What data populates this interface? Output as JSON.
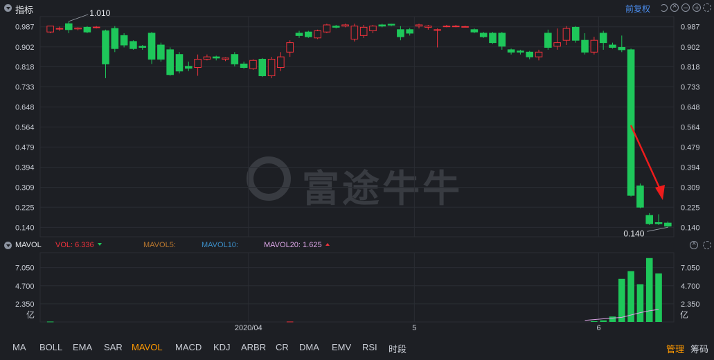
{
  "header": {
    "title": "指标",
    "adjust_label": "前复权"
  },
  "colors": {
    "up": "#f0323c",
    "down": "#1ec75a",
    "grid": "#2a2d33",
    "axis_text": "#c8ccd4",
    "mavol20": "#dba5e6",
    "arrow": "#ee1c1c"
  },
  "chart_data": [
    {
      "type": "candlestick",
      "y_ticks": [
        "0.987",
        "0.902",
        "0.818",
        "0.733",
        "0.648",
        "0.564",
        "0.479",
        "0.394",
        "0.309",
        "0.225",
        "0.140"
      ],
      "ylim": [
        0.1,
        1.03
      ],
      "x_labels": [
        {
          "label": "2020/04",
          "index": 22
        },
        {
          "label": "5",
          "index": 40
        },
        {
          "label": "6",
          "index": 60
        }
      ],
      "annotations": {
        "high": "1.010",
        "low": "0.140"
      },
      "candles": [
        {
          "o": 0.965,
          "h": 0.99,
          "l": 0.96,
          "c": 0.99
        },
        {
          "o": 0.978,
          "h": 0.988,
          "l": 0.97,
          "c": 0.98
        },
        {
          "o": 1.0,
          "h": 1.01,
          "l": 0.96,
          "c": 0.975
        },
        {
          "o": 0.978,
          "h": 0.985,
          "l": 0.972,
          "c": 0.982
        },
        {
          "o": 0.985,
          "h": 0.99,
          "l": 0.96,
          "c": 0.965
        },
        {
          "o": 0.984,
          "h": 0.99,
          "l": 0.98,
          "c": 0.986
        },
        {
          "o": 0.97,
          "h": 0.975,
          "l": 0.77,
          "c": 0.83
        },
        {
          "o": 0.98,
          "h": 0.99,
          "l": 0.88,
          "c": 0.895
        },
        {
          "o": 0.95,
          "h": 0.96,
          "l": 0.9,
          "c": 0.91
        },
        {
          "o": 0.925,
          "h": 0.93,
          "l": 0.89,
          "c": 0.895
        },
        {
          "o": 0.905,
          "h": 0.91,
          "l": 0.89,
          "c": 0.9
        },
        {
          "o": 0.96,
          "h": 0.965,
          "l": 0.83,
          "c": 0.85
        },
        {
          "o": 0.91,
          "h": 0.92,
          "l": 0.84,
          "c": 0.85
        },
        {
          "o": 0.89,
          "h": 0.9,
          "l": 0.78,
          "c": 0.785
        },
        {
          "o": 0.87,
          "h": 0.88,
          "l": 0.79,
          "c": 0.8
        },
        {
          "o": 0.82,
          "h": 0.84,
          "l": 0.8,
          "c": 0.812
        },
        {
          "o": 0.815,
          "h": 0.87,
          "l": 0.78,
          "c": 0.85
        },
        {
          "o": 0.85,
          "h": 0.87,
          "l": 0.845,
          "c": 0.86
        },
        {
          "o": 0.86,
          "h": 0.865,
          "l": 0.845,
          "c": 0.855
        },
        {
          "o": 0.85,
          "h": 0.858,
          "l": 0.842,
          "c": 0.855
        },
        {
          "o": 0.87,
          "h": 0.88,
          "l": 0.82,
          "c": 0.83
        },
        {
          "o": 0.83,
          "h": 0.84,
          "l": 0.81,
          "c": 0.815
        },
        {
          "o": 0.81,
          "h": 0.85,
          "l": 0.805,
          "c": 0.845
        },
        {
          "o": 0.85,
          "h": 0.855,
          "l": 0.775,
          "c": 0.78
        },
        {
          "o": 0.78,
          "h": 0.86,
          "l": 0.77,
          "c": 0.85
        },
        {
          "o": 0.815,
          "h": 0.88,
          "l": 0.8,
          "c": 0.86
        },
        {
          "o": 0.88,
          "h": 0.93,
          "l": 0.86,
          "c": 0.92
        },
        {
          "o": 0.96,
          "h": 0.97,
          "l": 0.94,
          "c": 0.95
        },
        {
          "o": 0.965,
          "h": 0.97,
          "l": 0.94,
          "c": 0.945
        },
        {
          "o": 0.94,
          "h": 0.975,
          "l": 0.935,
          "c": 0.97
        },
        {
          "o": 0.965,
          "h": 1.0,
          "l": 0.96,
          "c": 0.995
        },
        {
          "o": 0.99,
          "h": 0.995,
          "l": 0.98,
          "c": 0.985
        },
        {
          "o": 0.99,
          "h": 1.0,
          "l": 0.985,
          "c": 0.995
        },
        {
          "o": 0.935,
          "h": 1.0,
          "l": 0.925,
          "c": 0.99
        },
        {
          "o": 0.95,
          "h": 0.995,
          "l": 0.94,
          "c": 0.985
        },
        {
          "o": 0.97,
          "h": 0.995,
          "l": 0.96,
          "c": 0.99
        },
        {
          "o": 0.995,
          "h": 1.0,
          "l": 0.985,
          "c": 0.99
        },
        {
          "o": 0.998,
          "h": 1.0,
          "l": 0.99,
          "c": 0.994
        },
        {
          "o": 0.975,
          "h": 0.99,
          "l": 0.93,
          "c": 0.945
        },
        {
          "o": 0.975,
          "h": 0.982,
          "l": 0.95,
          "c": 0.96
        },
        {
          "o": 0.99,
          "h": 1.0,
          "l": 0.98,
          "c": 0.995
        },
        {
          "o": 0.985,
          "h": 0.995,
          "l": 0.975,
          "c": 0.99
        },
        {
          "o": 0.975,
          "h": 0.98,
          "l": 0.9,
          "c": 0.975
        },
        {
          "o": 0.99,
          "h": 0.995,
          "l": 0.985,
          "c": 0.99
        },
        {
          "o": 0.99,
          "h": 0.995,
          "l": 0.985,
          "c": 0.99
        },
        {
          "o": 0.988,
          "h": 0.992,
          "l": 0.985,
          "c": 0.988
        },
        {
          "o": 0.975,
          "h": 0.98,
          "l": 0.96,
          "c": 0.965
        },
        {
          "o": 0.96,
          "h": 0.965,
          "l": 0.94,
          "c": 0.945
        },
        {
          "o": 0.96,
          "h": 0.965,
          "l": 0.915,
          "c": 0.92
        },
        {
          "o": 0.96,
          "h": 0.965,
          "l": 0.89,
          "c": 0.905
        },
        {
          "o": 0.89,
          "h": 0.895,
          "l": 0.87,
          "c": 0.88
        },
        {
          "o": 0.885,
          "h": 0.89,
          "l": 0.87,
          "c": 0.88
        },
        {
          "o": 0.88,
          "h": 0.885,
          "l": 0.85,
          "c": 0.86
        },
        {
          "o": 0.86,
          "h": 0.89,
          "l": 0.845,
          "c": 0.88
        },
        {
          "o": 0.96,
          "h": 0.975,
          "l": 0.89,
          "c": 0.9
        },
        {
          "o": 0.905,
          "h": 0.98,
          "l": 0.89,
          "c": 0.92
        },
        {
          "o": 0.93,
          "h": 0.99,
          "l": 0.91,
          "c": 0.98
        },
        {
          "o": 0.985,
          "h": 0.99,
          "l": 0.92,
          "c": 0.93
        },
        {
          "o": 0.93,
          "h": 0.96,
          "l": 0.87,
          "c": 0.88
        },
        {
          "o": 0.88,
          "h": 0.945,
          "l": 0.87,
          "c": 0.93
        },
        {
          "o": 0.96,
          "h": 0.97,
          "l": 0.89,
          "c": 0.92
        },
        {
          "o": 0.91,
          "h": 0.92,
          "l": 0.895,
          "c": 0.9
        },
        {
          "o": 0.9,
          "h": 0.95,
          "l": 0.88,
          "c": 0.89
        },
        {
          "o": 0.89,
          "h": 0.895,
          "l": 0.27,
          "c": 0.275
        },
        {
          "o": 0.315,
          "h": 0.325,
          "l": 0.22,
          "c": 0.225
        },
        {
          "o": 0.19,
          "h": 0.2,
          "l": 0.15,
          "c": 0.155
        },
        {
          "o": 0.16,
          "h": 0.195,
          "l": 0.15,
          "c": 0.155
        },
        {
          "o": 0.158,
          "h": 0.165,
          "l": 0.14,
          "c": 0.145
        }
      ]
    },
    {
      "type": "bar",
      "indicator": "MAVOL",
      "unit": "亿",
      "y_ticks": [
        "7.050",
        "4.700",
        "2.350"
      ],
      "ylim": [
        0,
        9.0
      ],
      "volumes": [
        0.05,
        0,
        0,
        0,
        0,
        0,
        0,
        0,
        0,
        0,
        0,
        0,
        0,
        0,
        0,
        0,
        0,
        0,
        0,
        0,
        0,
        0,
        0,
        0,
        0,
        0,
        0.05,
        0,
        0,
        0,
        0,
        0,
        0,
        0,
        0,
        0,
        0,
        0,
        0,
        0,
        0,
        0,
        0,
        0,
        0,
        0,
        0,
        0,
        0,
        0,
        0,
        0,
        0,
        0,
        0,
        0,
        0,
        0,
        0,
        0.1,
        0.2,
        0.7,
        5.6,
        6.6,
        4.9,
        8.3,
        6.3
      ],
      "vol_up": [
        false,
        false,
        false,
        false,
        false,
        false,
        false,
        false,
        false,
        false,
        false,
        false,
        false,
        false,
        false,
        false,
        false,
        false,
        false,
        false,
        false,
        false,
        false,
        false,
        false,
        false,
        true,
        false,
        false,
        false,
        false,
        false,
        false,
        false,
        false,
        false,
        false,
        false,
        false,
        false,
        false,
        false,
        false,
        false,
        false,
        false,
        false,
        false,
        false,
        false,
        false,
        false,
        false,
        false,
        false,
        false,
        false,
        false,
        false,
        false,
        false,
        false,
        false,
        false,
        false,
        false,
        false
      ],
      "mavol20": [
        0.2,
        0.3,
        0.4,
        0.5,
        0.6,
        0.9,
        1.2,
        1.45,
        1.625
      ]
    }
  ],
  "volume_header": {
    "name": "MAVOL",
    "vol_label": "VOL: 6.336",
    "mavol5_label": "MAVOL5:",
    "mavol10_label": "MAVOL10:",
    "mavol20_label": "MAVOL20: 1.625"
  },
  "indicator_tabs": [
    "MA",
    "BOLL",
    "EMA",
    "SAR",
    "MAVOL",
    "MACD",
    "KDJ",
    "ARBR",
    "CR",
    "DMA",
    "EMV",
    "RSI",
    "时段"
  ],
  "active_tab": "MAVOL",
  "right_tabs": [
    "管理",
    "筹码"
  ],
  "watermark": "富途牛牛"
}
